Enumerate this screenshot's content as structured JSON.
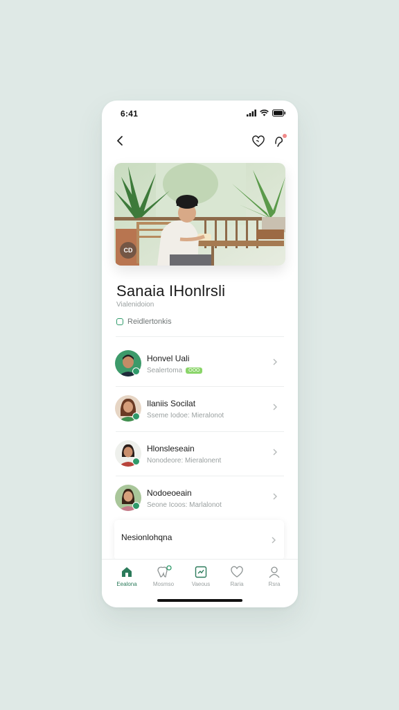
{
  "status_bar": {
    "time": "6:41"
  },
  "profile": {
    "name": "Sanaia IHonlrsli",
    "subtitle": "Vialenidoion",
    "tagline": "Reidlertonkis"
  },
  "hero": {
    "badge": "CD"
  },
  "list": [
    {
      "title": "Honvel Uali",
      "subtitle": "Sealertoma",
      "pill": "OOO"
    },
    {
      "title": "Ilaniis Socilat",
      "subtitle": "Sseme Iodoe: Mieralonot",
      "pill": ""
    },
    {
      "title": "Hlonsleseain",
      "subtitle": "Nonodeore: Mieralonent",
      "pill": ""
    },
    {
      "title": "Nodoeoeain",
      "subtitle": "Seone Icoos: Marlalonot",
      "pill": ""
    }
  ],
  "card_row": {
    "label": "Nesionlohqna"
  },
  "tabs": [
    {
      "label": "Eealona",
      "icon": "home-icon",
      "active": true
    },
    {
      "label": "Mosmso",
      "icon": "tooth-icon",
      "active": false
    },
    {
      "label": "Vaeous",
      "icon": "chart-icon",
      "active": false
    },
    {
      "label": "Raria",
      "icon": "heart-icon",
      "active": false
    },
    {
      "label": "Rsra",
      "icon": "profile-icon",
      "active": false
    }
  ],
  "colors": {
    "accent": "#2b7a5a",
    "background": "#dfe9e6",
    "badge_green": "#8bd56a",
    "notif": "#f08a8a"
  }
}
